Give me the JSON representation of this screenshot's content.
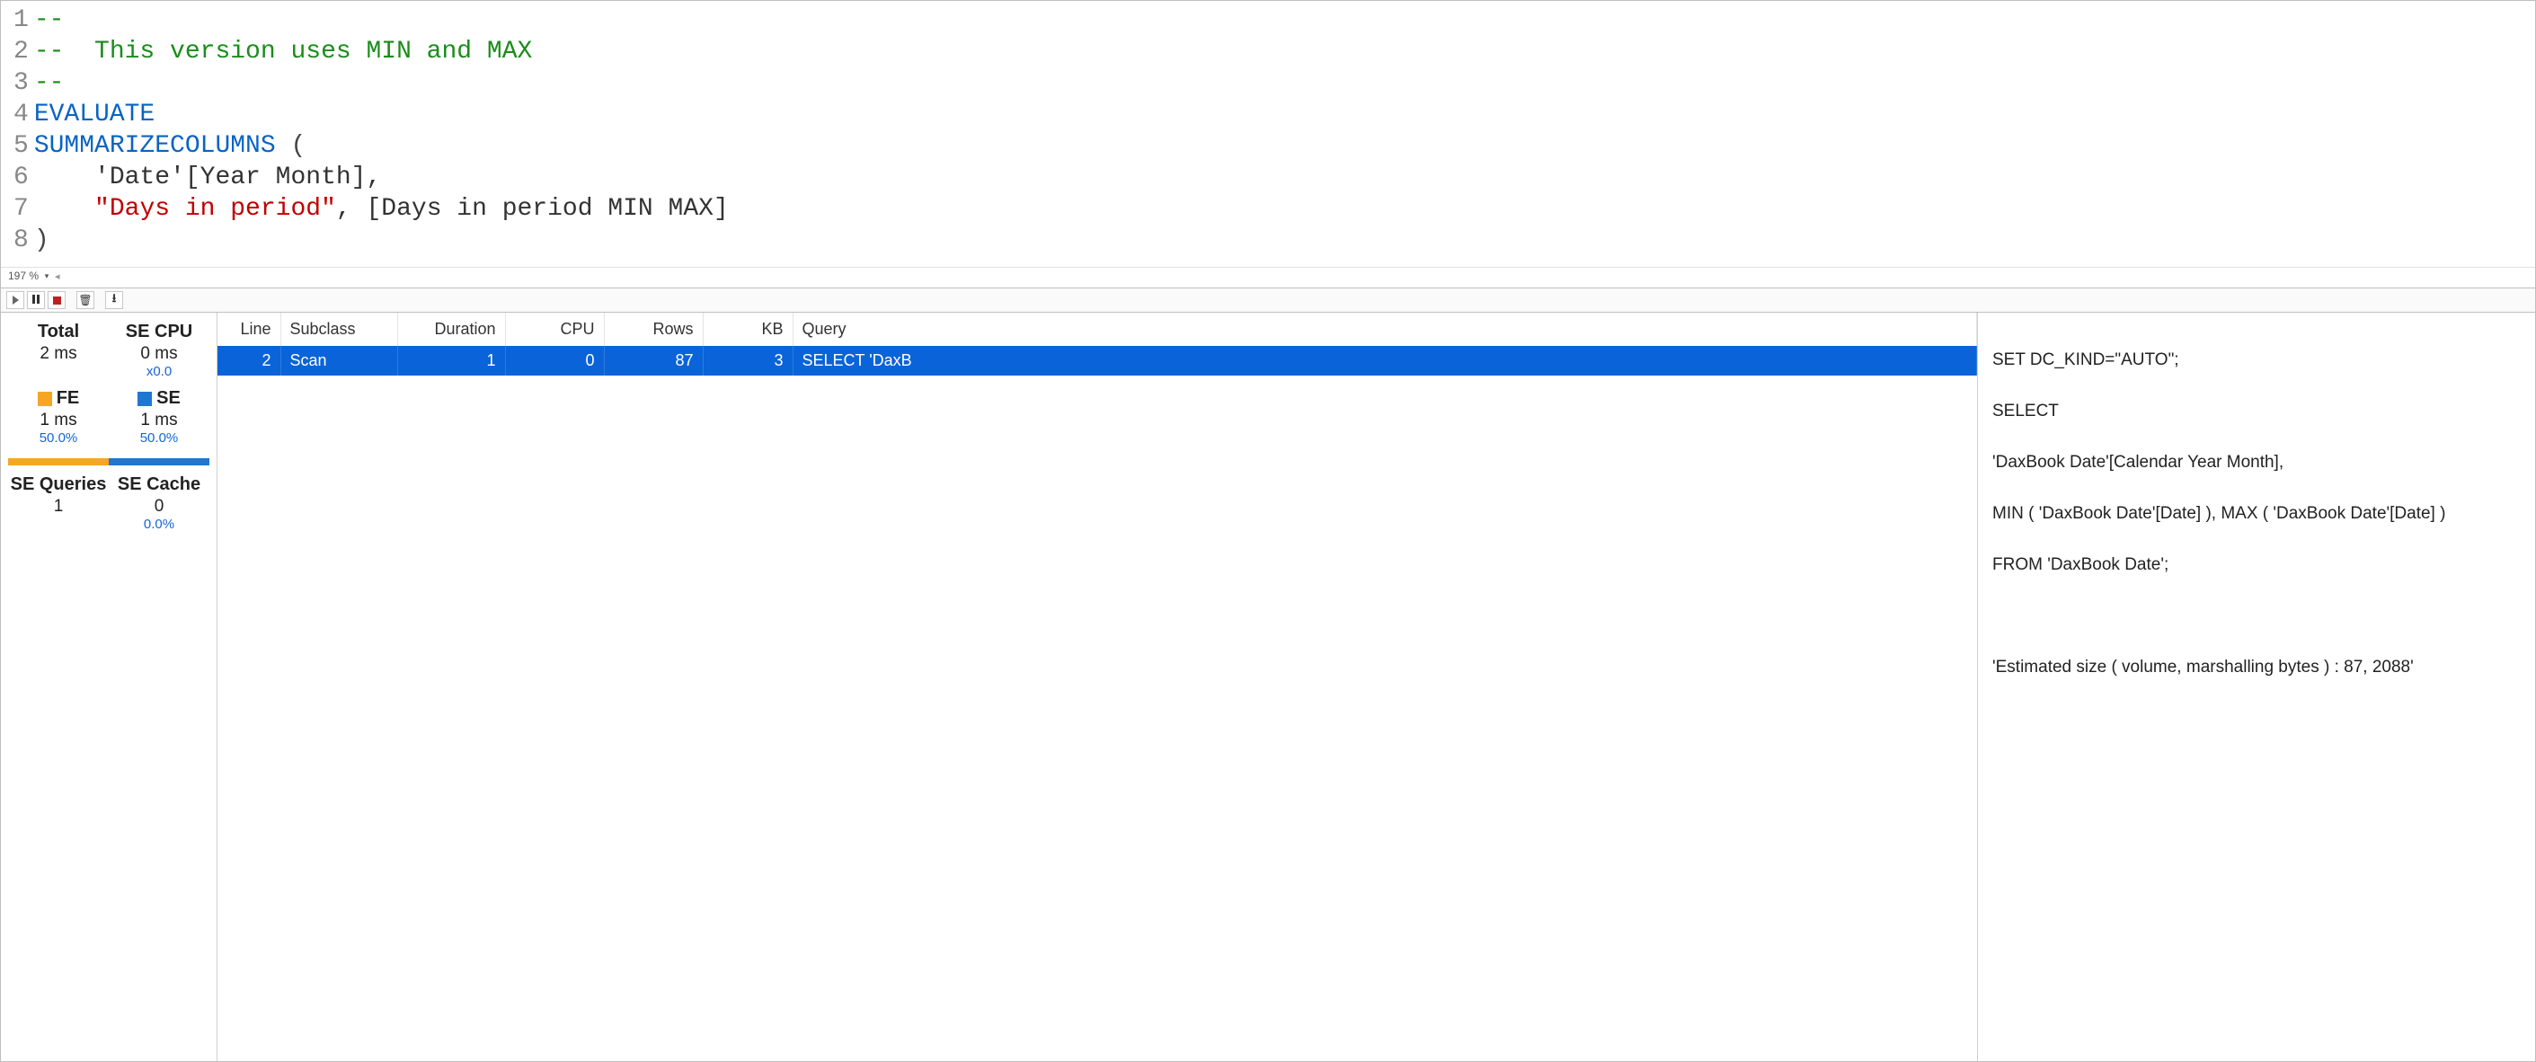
{
  "editor": {
    "lines": [
      {
        "n": "1",
        "tokens": [
          {
            "cls": "tok-comment",
            "t": "--"
          }
        ]
      },
      {
        "n": "2",
        "tokens": [
          {
            "cls": "tok-comment",
            "t": "--  This version uses MIN and MAX"
          }
        ]
      },
      {
        "n": "3",
        "tokens": [
          {
            "cls": "tok-comment",
            "t": "--"
          }
        ]
      },
      {
        "n": "4",
        "tokens": [
          {
            "cls": "tok-keyword",
            "t": "EVALUATE"
          }
        ]
      },
      {
        "n": "5",
        "tokens": [
          {
            "cls": "tok-keyword",
            "t": "SUMMARIZECOLUMNS"
          },
          {
            "cls": "tok-plain",
            "t": " "
          },
          {
            "cls": "tok-bracket",
            "t": "("
          }
        ]
      },
      {
        "n": "6",
        "tokens": [
          {
            "cls": "tok-plain",
            "t": "    'Date'[Year Month],"
          }
        ]
      },
      {
        "n": "7",
        "tokens": [
          {
            "cls": "tok-plain",
            "t": "    "
          },
          {
            "cls": "tok-string",
            "t": "\"Days in period\""
          },
          {
            "cls": "tok-plain",
            "t": ", [Days in period MIN MAX]"
          }
        ]
      },
      {
        "n": "8",
        "tokens": [
          {
            "cls": "tok-bracket",
            "t": ")"
          }
        ]
      }
    ]
  },
  "zoom": {
    "level": "197 %",
    "arrow": "◂"
  },
  "toolbar": {
    "play": "Run",
    "pause": "Pause",
    "stop": "Stop",
    "clear": "Clear",
    "export": "Export"
  },
  "stats": {
    "total": {
      "label": "Total",
      "value": "2 ms"
    },
    "secpu": {
      "label": "SE CPU",
      "value": "0 ms",
      "sub": "x0.0"
    },
    "fe": {
      "label": "FE",
      "value": "1 ms",
      "pct": "50.0%"
    },
    "se": {
      "label": "SE",
      "value": "1 ms",
      "pct": "50.0%"
    },
    "bar_se_pct": 50,
    "seq": {
      "label": "SE Queries",
      "value": "1"
    },
    "secache": {
      "label": "SE Cache",
      "value": "0",
      "sub": "0.0%"
    }
  },
  "xm": {
    "headers": {
      "line": "Line",
      "subclass": "Subclass",
      "duration": "Duration",
      "cpu": "CPU",
      "rows": "Rows",
      "kb": "KB",
      "query": "Query"
    },
    "rows": [
      {
        "line": "2",
        "subclass": "Scan",
        "duration": "1",
        "cpu": "0",
        "rows": "87",
        "kb": "3",
        "query": "SELECT 'DaxB"
      }
    ]
  },
  "detail": {
    "l1": "SET DC_KIND=\"AUTO\";",
    "l2": "SELECT",
    "l3": "'DaxBook Date'[Calendar Year Month],",
    "l4": "MIN ( 'DaxBook Date'[Date] ), MAX ( 'DaxBook Date'[Date] )",
    "l5": "FROM 'DaxBook Date';",
    "blank": "",
    "l6": "'Estimated size ( volume, marshalling bytes ) : 87, 2088'"
  }
}
